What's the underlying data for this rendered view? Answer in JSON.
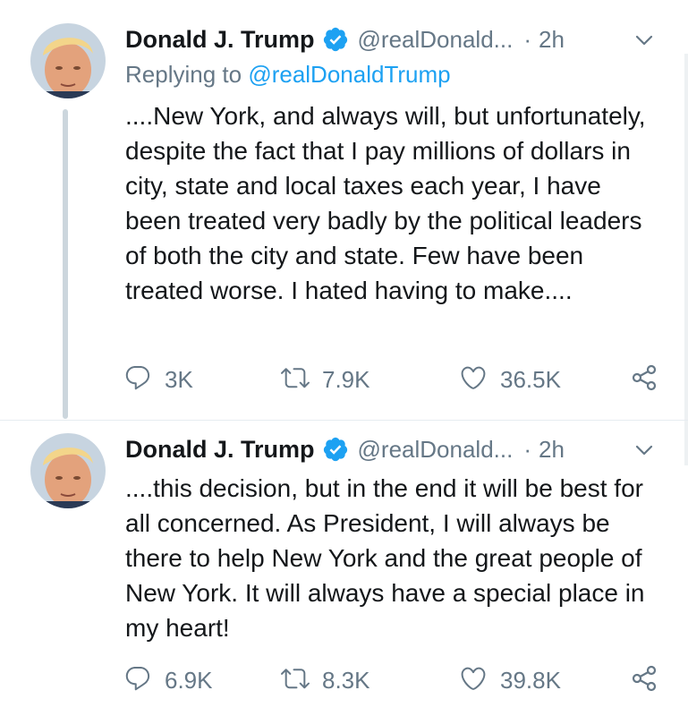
{
  "colors": {
    "text": "#14171a",
    "secondary": "#657786",
    "accent": "#1da1f2",
    "thread_line": "#ccd6dd"
  },
  "tweets": [
    {
      "author_name": "Donald J. Trump",
      "handle": "@realDonald...",
      "separator": "·",
      "time": "2h",
      "reply_prefix": "Replying to",
      "reply_mention": "@realDonaldTrump",
      "text": "....New York, and always will, but unfortunately, despite the fact that I pay millions of dollars in city, state and local taxes each year, I have been treated very badly by the political leaders of both the city and state. Few have been treated worse. I hated having to make....",
      "replies": "3K",
      "retweets": "7.9K",
      "likes": "36.5K",
      "icons": [
        "verified-icon",
        "chevron-down-icon",
        "reply-icon",
        "retweet-icon",
        "like-icon",
        "share-icon"
      ]
    },
    {
      "author_name": "Donald J. Trump",
      "handle": "@realDonald...",
      "separator": "·",
      "time": "2h",
      "text": "....this decision, but in the end it will be best for all concerned. As President, I will always be there to help New York and the great people of New York. It will always have a special place in my heart!",
      "replies": "6.9K",
      "retweets": "8.3K",
      "likes": "39.8K",
      "icons": [
        "verified-icon",
        "chevron-down-icon",
        "reply-icon",
        "retweet-icon",
        "like-icon",
        "share-icon"
      ]
    }
  ]
}
